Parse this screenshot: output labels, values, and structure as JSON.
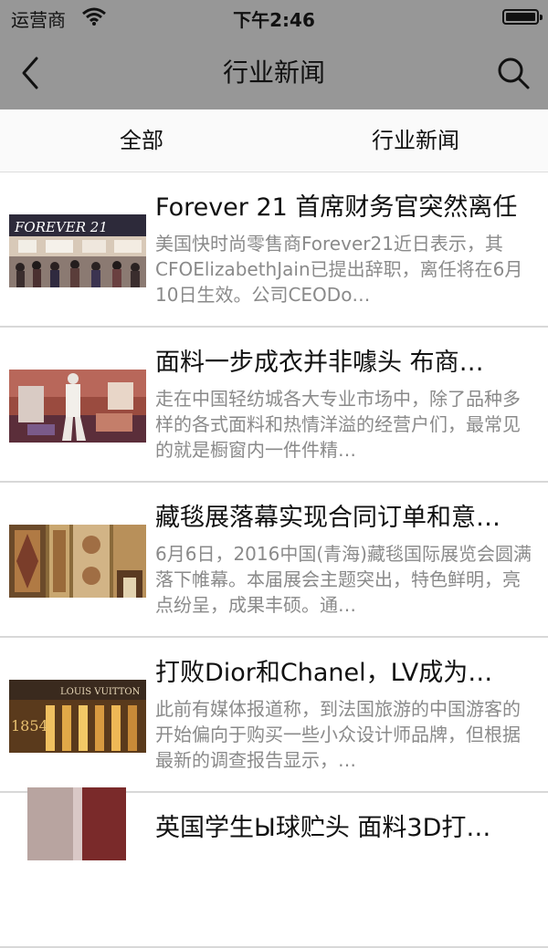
{
  "status_bar": {
    "carrier": "运营商",
    "time": "下午2:46"
  },
  "nav": {
    "title": "行业新闻",
    "back_icon": "chevron-left-icon",
    "search_icon": "search-icon"
  },
  "tabs": [
    {
      "label": "全部"
    },
    {
      "label": "行业新闻"
    }
  ],
  "news": [
    {
      "title": "Forever 21 首席财务官突然离任",
      "summary": "美国快时尚零售商Forever21近日表示，其CFOElizabethJain已提出辞职，离任将在6月10日生效。公司CEODo…",
      "thumb_text": "FOREVER 21"
    },
    {
      "title": "面料一步成衣并非噱头 布商…",
      "summary": "走在中国轻纺城各大专业市场中，除了品种多样的各式面料和热情洋溢的经营户们，最常见的就是橱窗内一件件精…"
    },
    {
      "title": "藏毯展落幕实现合同订单和意…",
      "summary": "6月6日，2016中国(青海)藏毯国际展览会圆满落下帷幕。本届展会主题突出，特色鲜明，亮点纷呈，成果丰硕。通…"
    },
    {
      "title": "打败Dior和Chanel，LV成为…",
      "summary": "此前有媒体报道称，到法国旅游的中国游客的开始偏向于购买一些小众设计师品牌，但根据最新的调查报告显示，…",
      "thumb_text": "LOUIS VUITTON",
      "thumb_text_2": "1854"
    },
    {
      "title": "英国学生Ы球贮头 面料3D打…",
      "summary": ""
    }
  ]
}
